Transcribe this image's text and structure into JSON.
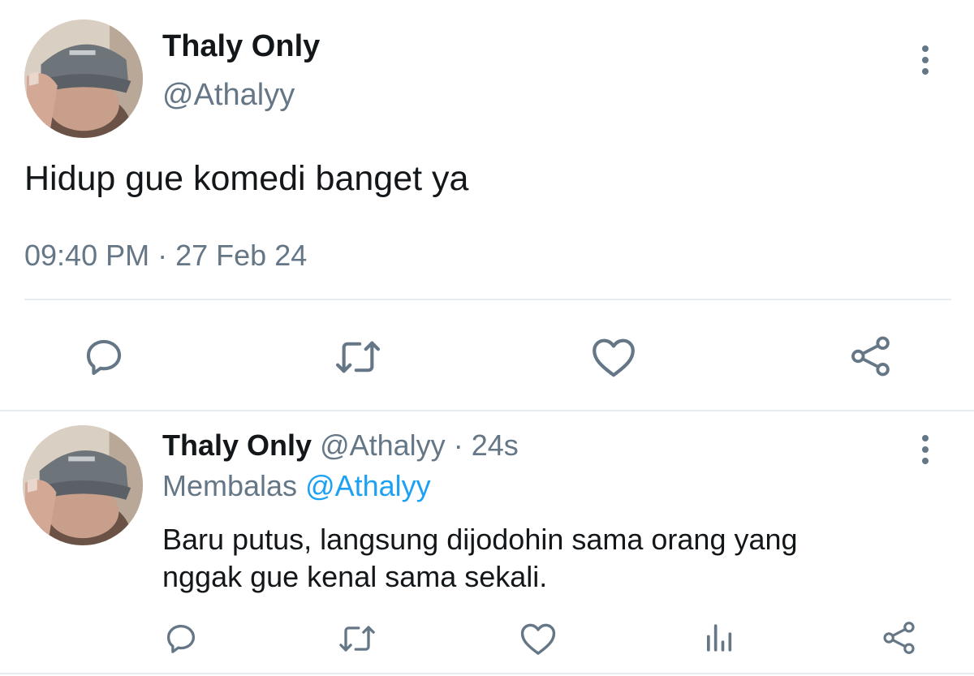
{
  "main_tweet": {
    "display_name": "Thaly Only",
    "handle": "@Athalyy",
    "text": "Hidup gue komedi banget ya",
    "time": "09:40 PM",
    "separator": "·",
    "date": "27 Feb 24",
    "actions": [
      "reply-icon",
      "retweet-icon",
      "like-icon",
      "share-icon"
    ]
  },
  "reply_tweet": {
    "display_name": "Thaly Only",
    "handle": "@Athalyy",
    "separator": "·",
    "age": "24s",
    "replying_label": "Membalas",
    "replying_to": "@Athalyy",
    "text_line1": "Baru putus, langsung dijodohin sama orang yang",
    "text_line2": "nggak gue kenal sama sekali.",
    "actions": [
      "reply-icon",
      "retweet-icon",
      "like-icon",
      "analytics-icon",
      "share-icon"
    ]
  },
  "colors": {
    "text": "#14171a",
    "secondary": "#657786",
    "link": "#1da1f2",
    "divider": "#e6ecf0"
  }
}
